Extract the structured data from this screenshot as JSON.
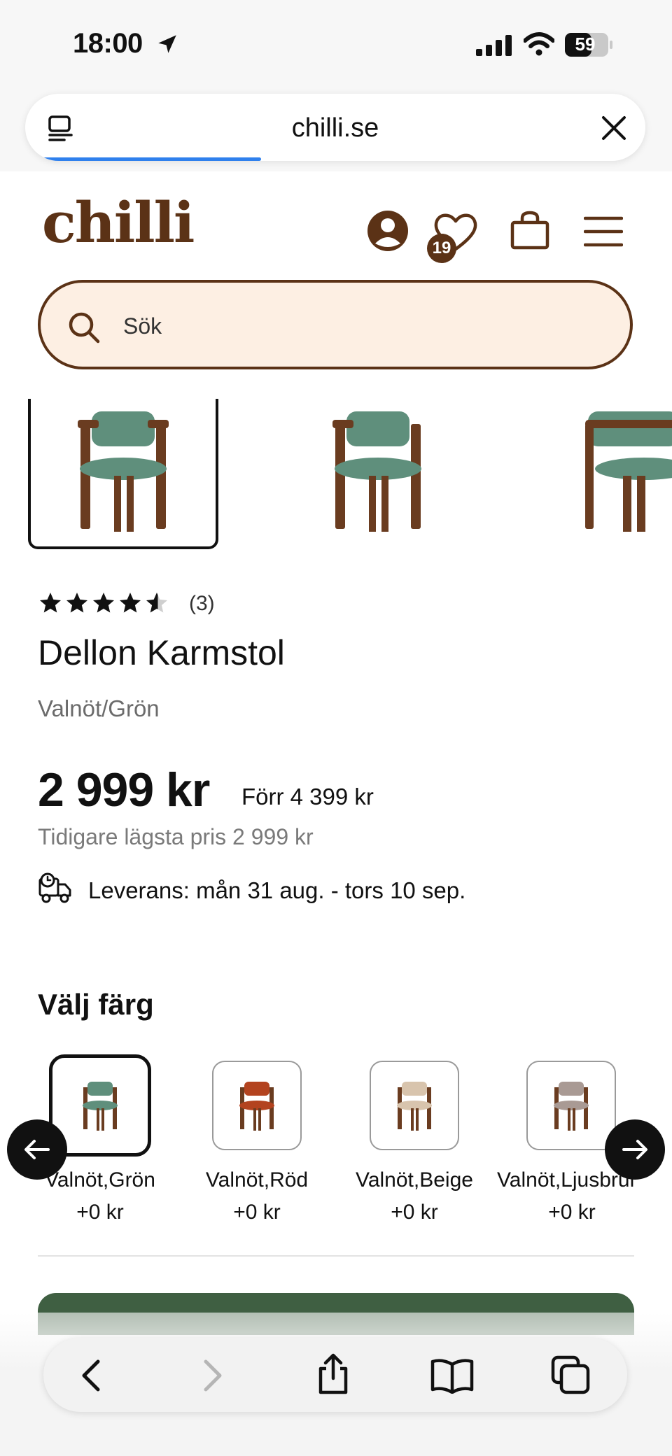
{
  "status_bar": {
    "time": "18:00",
    "battery": "59"
  },
  "browser": {
    "url": "chilli.se",
    "load_progress": 0.38
  },
  "site": {
    "logo": "chilli",
    "wishlist_count": "19",
    "search_placeholder": "Sök"
  },
  "product": {
    "rating": 4.5,
    "review_count": "(3)",
    "title": "Dellon Karmstol",
    "variant": "Valnöt/Grön",
    "price": "2 999 kr",
    "old_price": "Förr 4 399 kr",
    "lowest_price": "Tidigare lägsta pris 2 999 kr",
    "delivery": "Leverans: mån 31 aug. - tors 10 sep."
  },
  "color_selector": {
    "heading": "Välj färg",
    "options": [
      {
        "label": "Valnöt,Grön",
        "price": "+0 kr",
        "color": "#5f8f7c",
        "selected": true
      },
      {
        "label": "Valnöt,Röd",
        "price": "+0 kr",
        "color": "#b3431f",
        "selected": false
      },
      {
        "label": "Valnöt,Beige",
        "price": "+0 kr",
        "color": "#d8c4ad",
        "selected": false
      },
      {
        "label": "Valnöt,Ljusbrun",
        "price": "+0 kr",
        "color": "#a99a94",
        "selected": false
      }
    ]
  },
  "colors": {
    "brand_brown": "#5b3216",
    "search_bg": "#fdefe3",
    "cta_green": "#3f5f42",
    "chair_seat": "#5f8f7c",
    "chair_wood": "#6a3c20"
  },
  "icons": {
    "header": [
      "account-icon",
      "heart-icon",
      "bag-icon",
      "menu-icon"
    ],
    "toolbar": [
      "back-icon",
      "forward-icon",
      "share-icon",
      "bookmarks-icon",
      "tabs-icon"
    ]
  }
}
